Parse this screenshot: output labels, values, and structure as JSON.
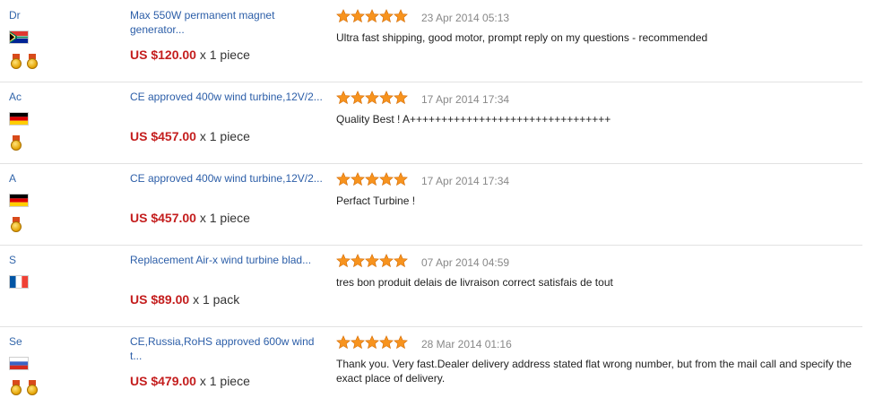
{
  "reviews": [
    {
      "buyer": "Dr",
      "flag": "ZA",
      "medals": 2,
      "product": "Max 550W permanent magnet generator...",
      "price": "US $120.00",
      "quantity": "x 1 piece",
      "rating": 5,
      "date": "23 Apr 2014 05:13",
      "comment": "Ultra fast shipping, good motor, prompt reply on my questions - recommended"
    },
    {
      "buyer": "Ac",
      "flag": "DE",
      "medals": 1,
      "product": "CE approved 400w wind turbine,12V/2...",
      "price": "US $457.00",
      "quantity": "x 1 piece",
      "rating": 5,
      "date": "17 Apr 2014 17:34",
      "comment": "Quality Best ! A++++++++++++++++++++++++++++++++"
    },
    {
      "buyer": "A",
      "flag": "DE",
      "medals": 1,
      "product": "CE approved 400w wind turbine,12V/2...",
      "price": "US $457.00",
      "quantity": "x 1 piece",
      "rating": 5,
      "date": "17 Apr 2014 17:34",
      "comment": "Perfact Turbine !"
    },
    {
      "buyer": "S",
      "flag": "FR",
      "medals": 0,
      "product": "Replacement Air-x wind turbine blad...",
      "price": "US $89.00",
      "quantity": "x 1 pack",
      "rating": 5,
      "date": "07 Apr 2014 04:59",
      "comment": "tres bon produit delais de livraison correct satisfais de tout"
    },
    {
      "buyer": "Se",
      "flag": "RU",
      "medals": 2,
      "product": "CE,Russia,RoHS approved 600w wind t...",
      "price": "US $479.00",
      "quantity": "x 1 piece",
      "rating": 5,
      "date": "28 Mar 2014 01:16",
      "comment": "Thank you. Very fast.Dealer delivery address stated flat wrong number, but from the mail call and specify the exact place of delivery."
    }
  ],
  "colors": {
    "link": "#2c5ea8",
    "price": "#c41e1e",
    "star": "#f7931e",
    "date": "#888888"
  },
  "icons": {
    "star": "star-icon",
    "medal": "medal-icon",
    "flag": "country-flag-icon"
  }
}
